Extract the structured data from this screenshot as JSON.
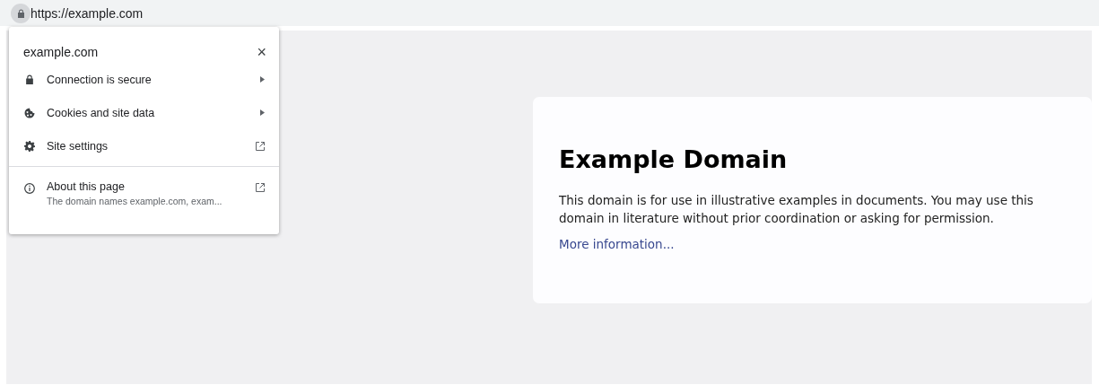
{
  "address_bar": {
    "url": "https://example.com"
  },
  "site_info_popup": {
    "title": "example.com",
    "close": "×",
    "items": [
      {
        "label": "Connection is secure",
        "kind": "submenu"
      },
      {
        "label": "Cookies and site data",
        "kind": "submenu"
      },
      {
        "label": "Site settings",
        "kind": "external"
      }
    ],
    "about": {
      "label": "About this page",
      "description": "The domain names example.com, exam...",
      "kind": "external"
    }
  },
  "page": {
    "heading": "Example Domain",
    "paragraph": "This domain is for use in illustrative examples in documents. You may use this domain in literature without prior coordination or asking for permission.",
    "link": "More information..."
  }
}
